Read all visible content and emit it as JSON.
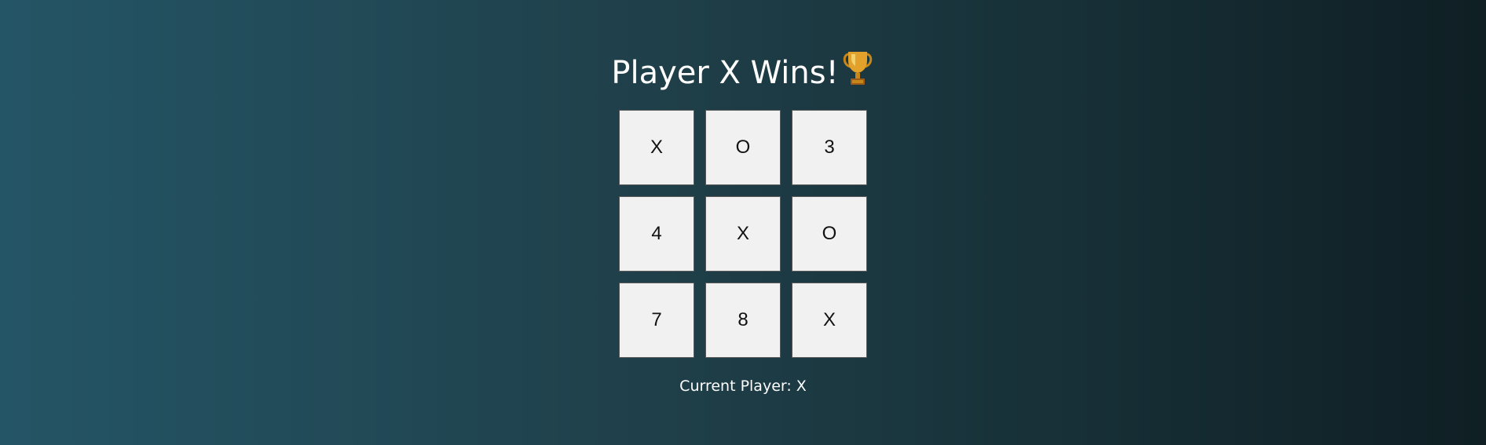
{
  "game": {
    "title": "Player X Wins!",
    "title_icon": "trophy-icon",
    "board": [
      {
        "label": "X"
      },
      {
        "label": "O"
      },
      {
        "label": "3"
      },
      {
        "label": "4"
      },
      {
        "label": "X"
      },
      {
        "label": "O"
      },
      {
        "label": "7"
      },
      {
        "label": "8"
      },
      {
        "label": "X"
      }
    ],
    "status": "Current Player: X"
  },
  "colors": {
    "background_left": "#245566",
    "background_right": "#0f1f24",
    "cell_background": "#f1f1f1",
    "cell_border": "#5a5a5a",
    "text_light": "#ffffff",
    "trophy_gold": "#e1a12a"
  }
}
